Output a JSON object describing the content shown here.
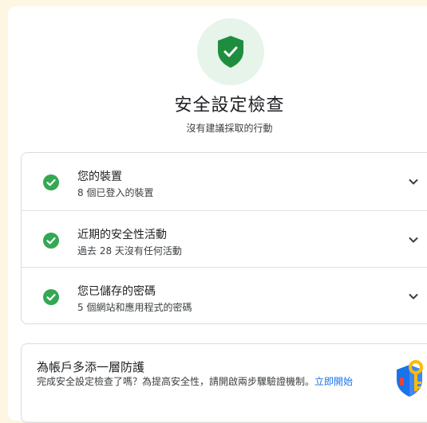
{
  "header": {
    "title": "安全設定檢查",
    "subtitle": "沒有建議採取的行動"
  },
  "checks": [
    {
      "title": "您的裝置",
      "subtitle": "8 個已登入的裝置"
    },
    {
      "title": "近期的安全性活動",
      "subtitle": "過去 28 天沒有任何活動"
    },
    {
      "title": "您已儲存的密碼",
      "subtitle": "5 個網站和應用程式的密碼"
    }
  ],
  "promo": {
    "title": "為帳戶多添一層防護",
    "text": "完成安全設定檢查了嗎？為提高安全性，請開啟兩步驟驗證機制。",
    "link": "立即開始"
  },
  "colors": {
    "shield": "#1e8e3e",
    "ok": "#34a853",
    "link": "#1a73e8"
  }
}
